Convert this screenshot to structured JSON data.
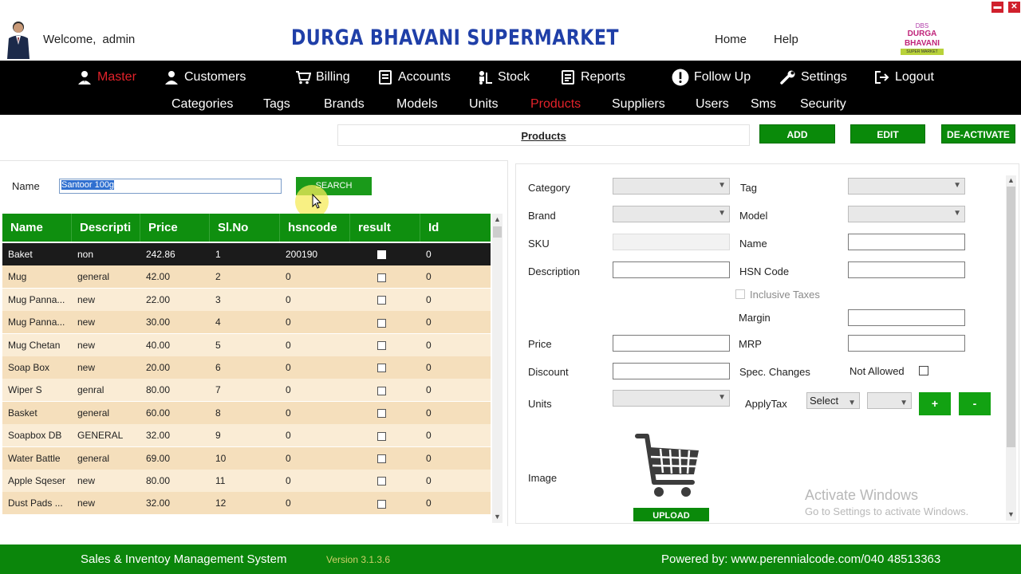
{
  "header": {
    "welcome": "Welcome,",
    "user": "admin",
    "store_name": "DURGA BHAVANI SUPERMARKET",
    "home": "Home",
    "help": "Help",
    "logo_top": "DBS",
    "logo_main": "DURGA BHAVANI",
    "logo_sub": "SUPER MARKET",
    "min_button": "▬",
    "close_button": "✕"
  },
  "nav": {
    "items": [
      {
        "label": "Master",
        "icon": "user-tie-icon",
        "active": true
      },
      {
        "label": "Customers",
        "icon": "user-icon"
      },
      {
        "label": "Billing",
        "icon": "cart-icon"
      },
      {
        "label": "Accounts",
        "icon": "document-icon"
      },
      {
        "label": "Stock",
        "icon": "forklift-icon"
      },
      {
        "label": "Reports",
        "icon": "report-icon"
      },
      {
        "label": "Follow Up",
        "icon": "alert-icon"
      },
      {
        "label": "Settings",
        "icon": "wrench-icon"
      },
      {
        "label": "Logout",
        "icon": "logout-icon"
      }
    ],
    "subitems": [
      "Categories",
      "Tags",
      "Brands",
      "Models",
      "Units",
      "Products",
      "Suppliers",
      "Users",
      "Sms",
      "Security"
    ],
    "active_sub": "Products"
  },
  "toolbar": {
    "title": "Products",
    "add": "ADD",
    "edit": "EDIT",
    "deactivate": "DE-ACTIVATE"
  },
  "search": {
    "label": "Name",
    "value": "Santoor 100g",
    "button": "SEARCH"
  },
  "grid": {
    "columns": [
      "Name",
      "Descripti",
      "Price",
      "Sl.No",
      "hsncode",
      "result",
      "Id"
    ],
    "rows": [
      {
        "name": "Baket",
        "desc": "non",
        "price": "242.86",
        "slno": "1",
        "hsn": "200190",
        "result": true,
        "id": "0"
      },
      {
        "name": "Mug",
        "desc": "general",
        "price": "42.00",
        "slno": "2",
        "hsn": "0",
        "result": false,
        "id": "0"
      },
      {
        "name": "Mug Panna...",
        "desc": "new",
        "price": "22.00",
        "slno": "3",
        "hsn": "0",
        "result": false,
        "id": "0"
      },
      {
        "name": "Mug Panna...",
        "desc": "new",
        "price": "30.00",
        "slno": "4",
        "hsn": "0",
        "result": false,
        "id": "0"
      },
      {
        "name": "Mug Chetan",
        "desc": "new",
        "price": "40.00",
        "slno": "5",
        "hsn": "0",
        "result": false,
        "id": "0"
      },
      {
        "name": "Soap Box",
        "desc": "new",
        "price": "20.00",
        "slno": "6",
        "hsn": "0",
        "result": false,
        "id": "0"
      },
      {
        "name": "Wiper S",
        "desc": "genral",
        "price": "80.00",
        "slno": "7",
        "hsn": "0",
        "result": false,
        "id": "0"
      },
      {
        "name": "Basket",
        "desc": "general",
        "price": "60.00",
        "slno": "8",
        "hsn": "0",
        "result": false,
        "id": "0"
      },
      {
        "name": "Soapbox DB",
        "desc": "GENERAL",
        "price": "32.00",
        "slno": "9",
        "hsn": "0",
        "result": false,
        "id": "0"
      },
      {
        "name": "Water Battle",
        "desc": "general",
        "price": "69.00",
        "slno": "10",
        "hsn": "0",
        "result": false,
        "id": "0"
      },
      {
        "name": "Apple Sqeser",
        "desc": "new",
        "price": "80.00",
        "slno": "11",
        "hsn": "0",
        "result": false,
        "id": "0"
      },
      {
        "name": "Dust Pads ...",
        "desc": "new",
        "price": "32.00",
        "slno": "12",
        "hsn": "0",
        "result": false,
        "id": "0"
      }
    ]
  },
  "form": {
    "category": "Category",
    "tag": "Tag",
    "brand": "Brand",
    "model": "Model",
    "sku": "SKU",
    "name": "Name",
    "description": "Description",
    "hsn_code": "HSN Code",
    "inclusive_taxes": "Inclusive Taxes",
    "margin": "Margin",
    "price": "Price",
    "mrp": "MRP",
    "discount": "Discount",
    "spec_changes": "Spec. Changes",
    "not_allowed": "Not Allowed",
    "units": "Units",
    "apply_tax": "ApplyTax",
    "apply_tax_select": "Select",
    "plus": "+",
    "minus": "-",
    "image": "Image",
    "upload": "UPLOAD"
  },
  "watermark": {
    "line1": "Activate Windows",
    "line2": "Go to Settings to activate Windows."
  },
  "footer": {
    "system": "Sales & Inventoy Management System",
    "version": "Version 3.1.3.6",
    "powered": "Powered by: www.perennialcode.com/040 48513363"
  },
  "colors": {
    "nav_bg": "#000000",
    "active": "#e3222a",
    "green": "#0f8f0f",
    "title_blue": "#1f3fa8",
    "row_odd": "#f5dfbc",
    "row_even": "#faecd5"
  }
}
